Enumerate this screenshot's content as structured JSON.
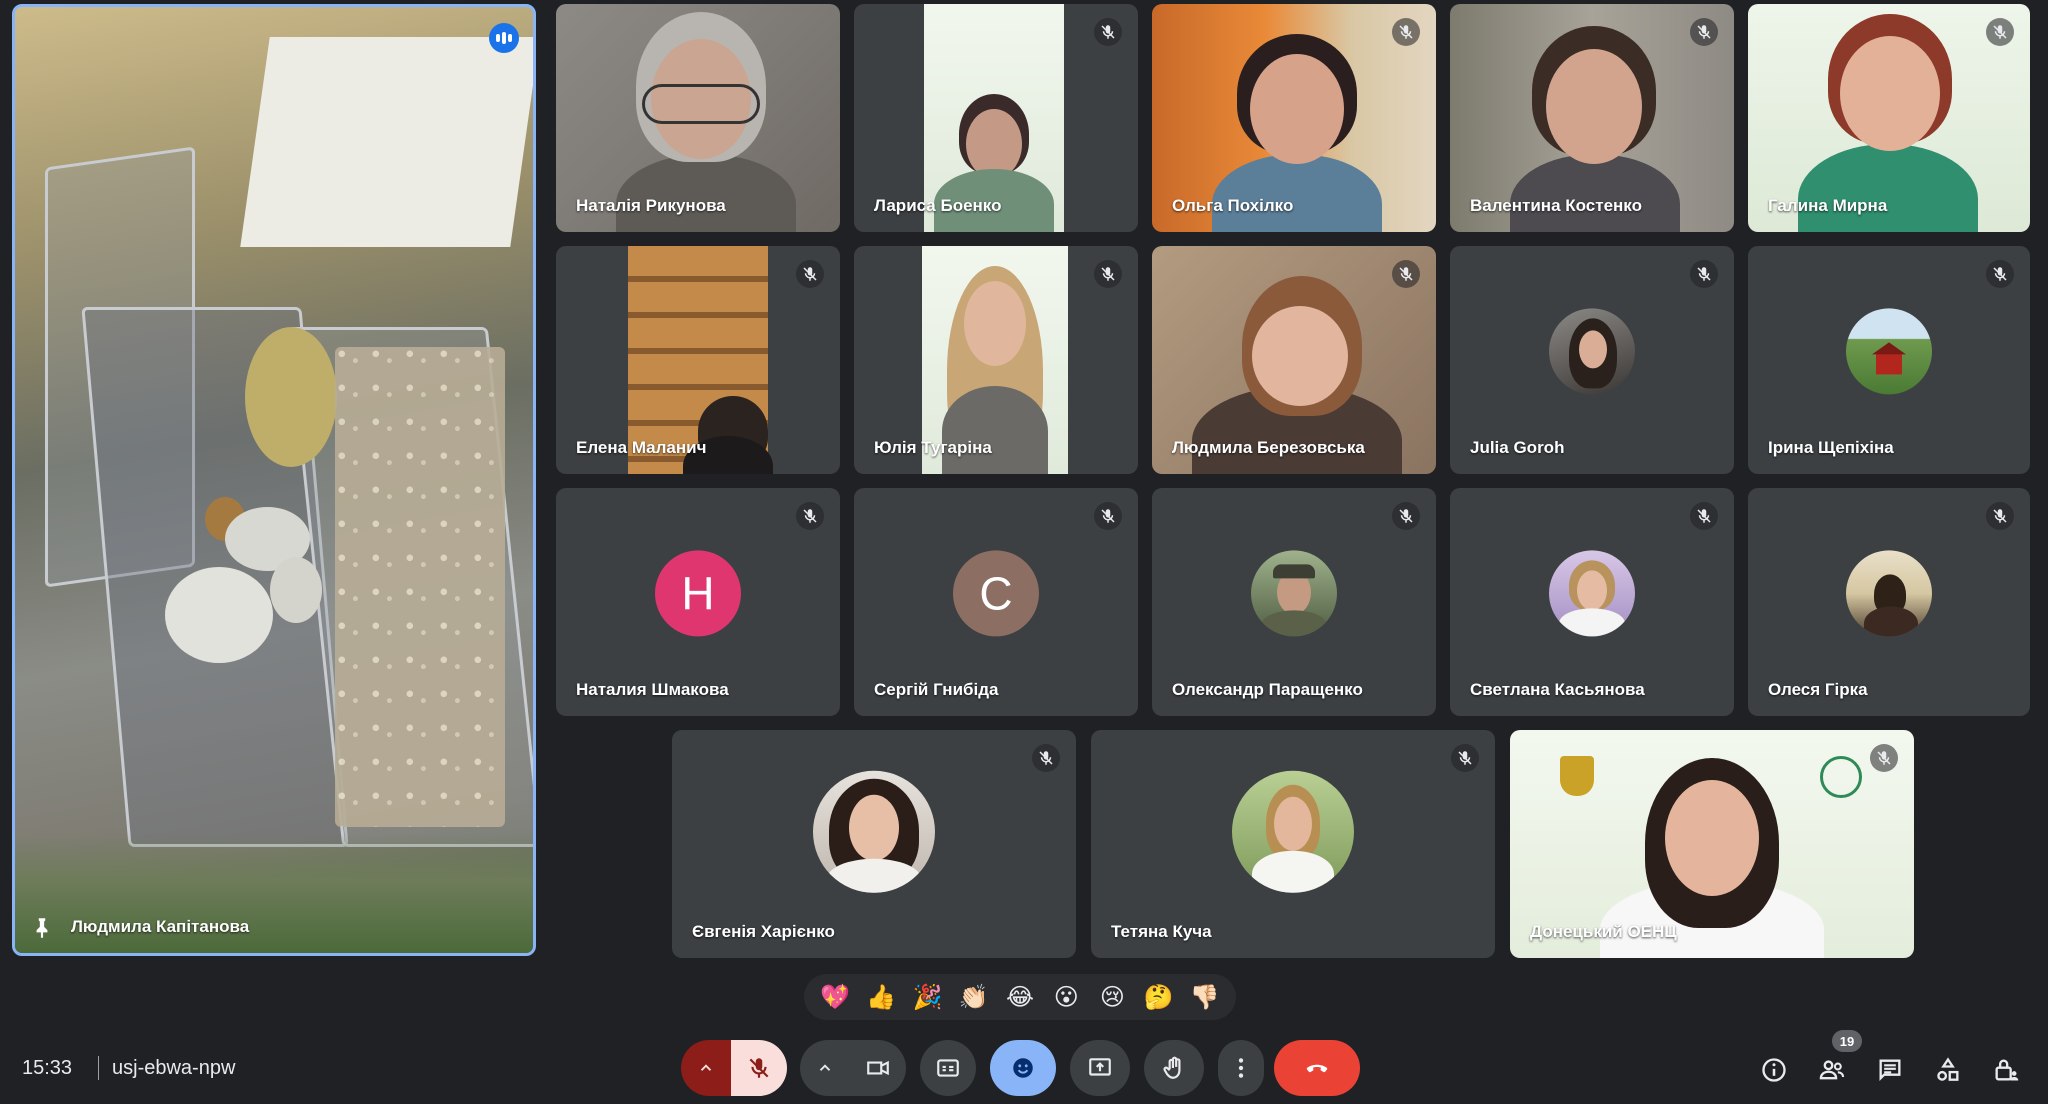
{
  "featured": {
    "name": "Людмила Капітанова"
  },
  "participants": [
    {
      "name": "Наталія Рикунова"
    },
    {
      "name": "Лариса Боенко"
    },
    {
      "name": "Ольга Похілко"
    },
    {
      "name": "Валентина Костенко"
    },
    {
      "name": "Галина Мирна"
    },
    {
      "name": "Елена Маланич"
    },
    {
      "name": "Юлія Тугаріна"
    },
    {
      "name": "Людмила Березовська"
    },
    {
      "name": "Julia Goroh"
    },
    {
      "name": "Ірина Щепіхіна"
    },
    {
      "name": "Наталия Шмакова",
      "initial": "Н",
      "avatar_color": "#e0366f"
    },
    {
      "name": "Сергій Гнибіда",
      "initial": "С",
      "avatar_color": "#8d6e63"
    },
    {
      "name": "Олександр Паращенко"
    },
    {
      "name": "Светлана Касьянова"
    },
    {
      "name": "Олеся Гірка"
    },
    {
      "name": "Євгенія Харієнко"
    },
    {
      "name": "Тетяна Куча"
    },
    {
      "name": "Донецький ОЕНЦ"
    }
  ],
  "reactions": [
    "💖",
    "👍",
    "🎉",
    "👏🏻",
    "😂",
    "😮",
    "😢",
    "🤔",
    "👎🏻"
  ],
  "bottom_bar": {
    "time": "15:33",
    "meeting_code": "usj-ebwa-npw",
    "participant_count": "19"
  },
  "colors": {
    "background": "#202124",
    "tile": "#3c4043",
    "end_call": "#ea4335",
    "mic_off": "#f9dedc",
    "mic_off_arrow": "#8c1d18",
    "active_button": "#8ab4f8"
  }
}
